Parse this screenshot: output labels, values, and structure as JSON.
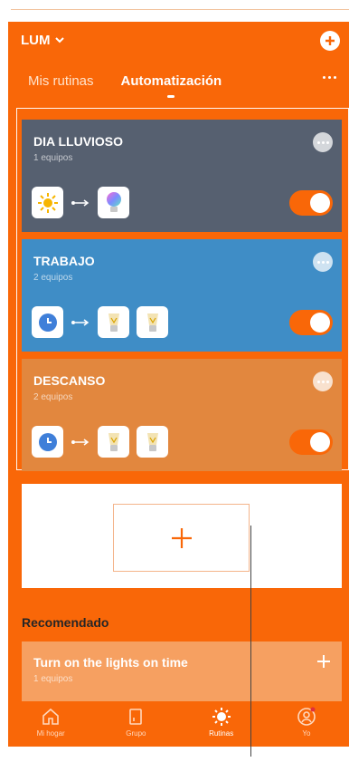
{
  "header": {
    "home_name": "LUM",
    "tabs": [
      {
        "label": "Mis rutinas",
        "active": false
      },
      {
        "label": "Automatización",
        "active": true
      }
    ]
  },
  "automations": [
    {
      "title": "DIA LLUVIOSO",
      "subtitle": "1 equipos",
      "enabled": true,
      "card_color": "#566070",
      "condition_icon": "sun-icon",
      "action_icons": [
        "color-bulb-icon"
      ]
    },
    {
      "title": "TRABAJO",
      "subtitle": "2 equipos",
      "enabled": true,
      "card_color": "#3f8dc6",
      "condition_icon": "clock-icon",
      "action_icons": [
        "bulb-icon",
        "bulb-icon"
      ]
    },
    {
      "title": "DESCANSO",
      "subtitle": "2 equipos",
      "enabled": true,
      "card_color": "#e2873e",
      "condition_icon": "clock-icon",
      "action_icons": [
        "bulb-icon",
        "bulb-icon"
      ]
    }
  ],
  "recommended": {
    "heading": "Recomendado",
    "items": [
      {
        "title": "Turn on the lights on time",
        "subtitle": "1 equipos"
      }
    ]
  },
  "tabbar": [
    {
      "label": "Mi hogar",
      "icon": "home-icon",
      "active": false
    },
    {
      "label": "Grupo",
      "icon": "group-icon",
      "active": false
    },
    {
      "label": "Rutinas",
      "icon": "routines-icon",
      "active": true
    },
    {
      "label": "Yo",
      "icon": "profile-icon",
      "active": false
    }
  ],
  "colors": {
    "accent": "#f96708",
    "rain_card": "#566070",
    "work_card": "#3f8dc6",
    "rest_card": "#e2873e"
  }
}
